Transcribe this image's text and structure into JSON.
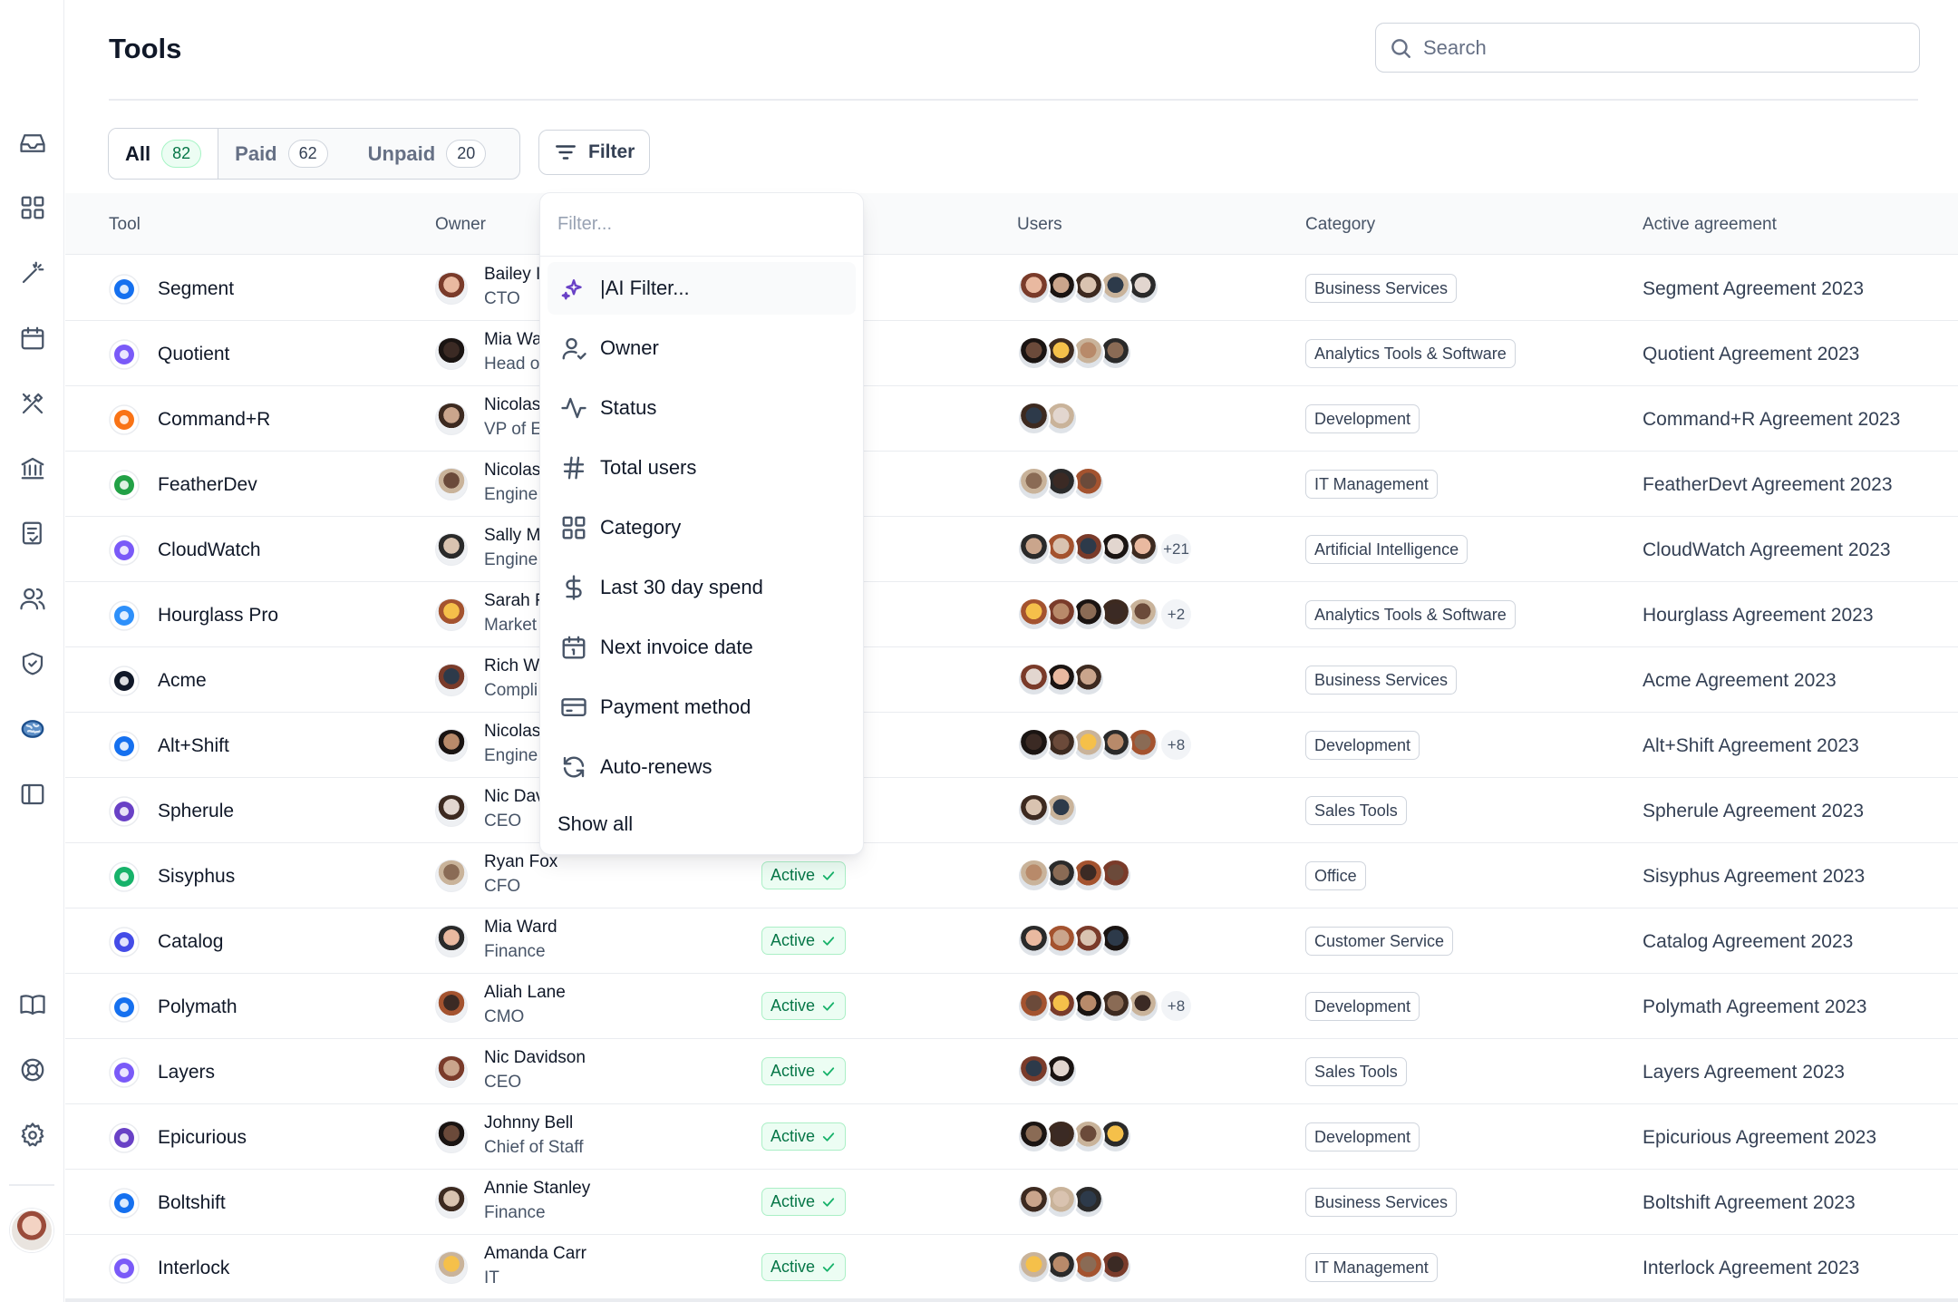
{
  "page": {
    "title": "Tools"
  },
  "search": {
    "placeholder": "Search"
  },
  "tabs": [
    {
      "label": "All",
      "count": "82"
    },
    {
      "label": "Paid",
      "count": "62"
    },
    {
      "label": "Unpaid",
      "count": "20"
    }
  ],
  "filter_button": {
    "label": "Filter"
  },
  "columns": {
    "tool": "Tool",
    "owner": "Owner",
    "users": "Users",
    "category": "Category",
    "agreement": "Active agreement"
  },
  "dropdown": {
    "placeholder": "Filter...",
    "items": [
      {
        "label": "|AI Filter...",
        "icon": "sparkle-icon"
      },
      {
        "label": "Owner",
        "icon": "user-check-icon"
      },
      {
        "label": "Status",
        "icon": "activity-icon"
      },
      {
        "label": "Total users",
        "icon": "hash-icon"
      },
      {
        "label": "Category",
        "icon": "grid-icon"
      },
      {
        "label": "Last 30 day spend",
        "icon": "dollar-icon"
      },
      {
        "label": "Next invoice date",
        "icon": "calendar-icon"
      },
      {
        "label": "Payment method",
        "icon": "credit-card-icon"
      },
      {
        "label": "Auto-renews",
        "icon": "refresh-icon"
      }
    ],
    "show_all": "Show all"
  },
  "rows": [
    {
      "tool": "Segment",
      "owner": "Bailey I",
      "role": "CTO",
      "status": "",
      "users": 5,
      "more": "",
      "category": "Business Services",
      "agreement": "Segment Agreement 2023",
      "color": "#1570ef"
    },
    {
      "tool": "Quotient",
      "owner": "Mia Wa",
      "role": "Head o",
      "status": "",
      "users": 4,
      "more": "",
      "category": "Analytics Tools & Software",
      "agreement": "Quotient Agreement 2023",
      "color": "#7a5af8"
    },
    {
      "tool": "Command+R",
      "owner": "Nicolas",
      "role": "VP of E",
      "status": "",
      "users": 2,
      "more": "",
      "category": "Development",
      "agreement": "Command+R Agreement 2023",
      "color": "#f97316"
    },
    {
      "tool": "FeatherDev",
      "owner": "Nicolas",
      "role": "Engine",
      "status": "",
      "users": 3,
      "more": "",
      "category": "IT Management",
      "agreement": "FeatherDevt Agreement 2023",
      "color": "#22a146"
    },
    {
      "tool": "CloudWatch",
      "owner": "Sally M",
      "role": "Engine",
      "status": "",
      "users": 5,
      "more": "+21",
      "category": "Artificial Intelligence",
      "agreement": "CloudWatch Agreement 2023",
      "color": "#7a5af8"
    },
    {
      "tool": "Hourglass Pro",
      "owner": "Sarah F",
      "role": "Market",
      "status": "",
      "users": 5,
      "more": "+2",
      "category": "Analytics Tools & Software",
      "agreement": "Hourglass Agreement 2023",
      "color": "#2e90fa"
    },
    {
      "tool": "Acme",
      "owner": "Rich W",
      "role": "Compli",
      "status": "",
      "users": 3,
      "more": "",
      "category": "Business Services",
      "agreement": "Acme Agreement 2023",
      "color": "#101828"
    },
    {
      "tool": "Alt+Shift",
      "owner": "Nicolas",
      "role": "Engine",
      "status": "",
      "users": 5,
      "more": "+8",
      "category": "Development",
      "agreement": "Alt+Shift Agreement 2023",
      "color": "#1570ef"
    },
    {
      "tool": "Spherule",
      "owner": "Nic Dav",
      "role": "CEO",
      "status": "",
      "users": 2,
      "more": "",
      "category": "Sales Tools",
      "agreement": "Spherule Agreement 2023",
      "color": "#6941c6"
    },
    {
      "tool": "Sisyphus",
      "owner": "Ryan Fox",
      "role": "CFO",
      "status": "Active",
      "users": 4,
      "more": "",
      "category": "Office",
      "agreement": "Sisyphus Agreement 2023",
      "color": "#17b26a"
    },
    {
      "tool": "Catalog",
      "owner": "Mia Ward",
      "role": "Finance",
      "status": "Active",
      "users": 4,
      "more": "",
      "category": "Customer Service",
      "agreement": "Catalog Agreement 2023",
      "color": "#444ce7"
    },
    {
      "tool": "Polymath",
      "owner": "Aliah Lane",
      "role": "CMO",
      "status": "Active",
      "users": 5,
      "more": "+8",
      "category": "Development",
      "agreement": "Polymath Agreement 2023",
      "color": "#1570ef"
    },
    {
      "tool": "Layers",
      "owner": "Nic Davidson",
      "role": "CEO",
      "status": "Active",
      "users": 2,
      "more": "",
      "category": "Sales Tools",
      "agreement": "Layers Agreement 2023",
      "color": "#7a5af8"
    },
    {
      "tool": "Epicurious",
      "owner": "Johnny Bell",
      "role": "Chief of Staff",
      "status": "Active",
      "users": 4,
      "more": "",
      "category": "Development",
      "agreement": "Epicurious Agreement 2023",
      "color": "#6941c6"
    },
    {
      "tool": "Boltshift",
      "owner": "Annie Stanley",
      "role": "Finance",
      "status": "Active",
      "users": 3,
      "more": "",
      "category": "Business Services",
      "agreement": "Boltshift Agreement 2023",
      "color": "#1570ef"
    },
    {
      "tool": "Interlock",
      "owner": "Amanda Carr",
      "role": "IT",
      "status": "Active",
      "users": 4,
      "more": "",
      "category": "IT Management",
      "agreement": "Interlock Agreement 2023",
      "color": "#7a5af8"
    }
  ]
}
